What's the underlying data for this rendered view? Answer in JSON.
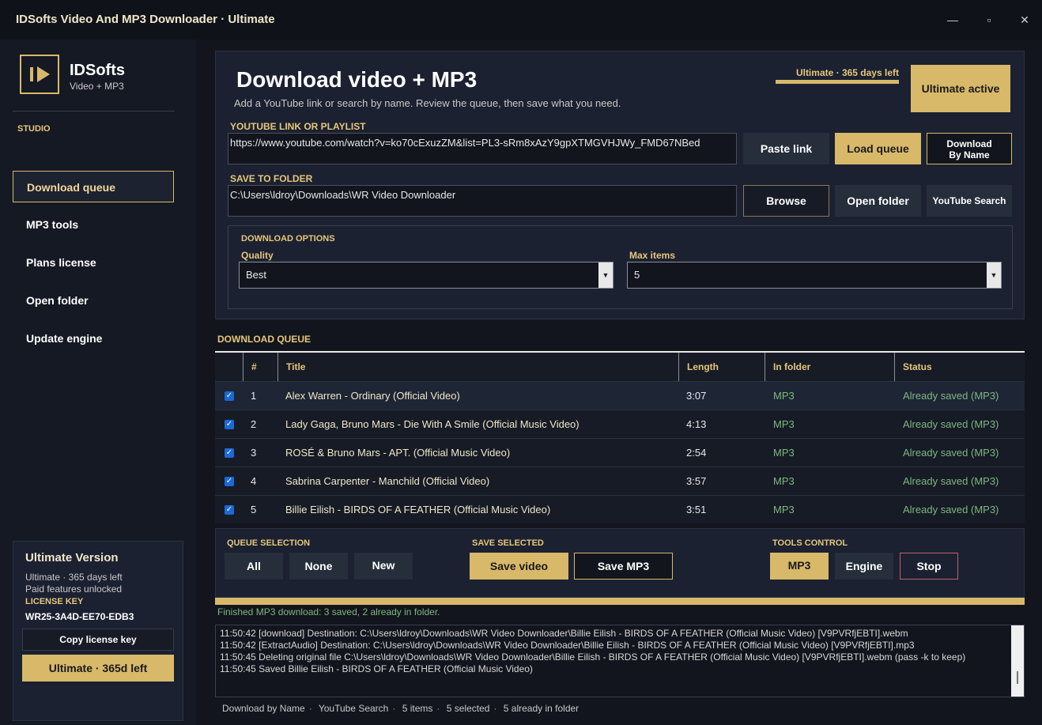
{
  "window": {
    "title": "IDSofts Video And MP3 Downloader  ·  Ultimate",
    "minimize": "—",
    "maximize": "▫",
    "close": "✕"
  },
  "sidebar": {
    "logo_name": "IDSofts",
    "logo_sub": "Video + MP3",
    "section": "STUDIO",
    "items": [
      {
        "label": "Download queue",
        "active": true
      },
      {
        "label": "MP3 tools",
        "active": false
      },
      {
        "label": "Plans  license",
        "active": false
      },
      {
        "label": "Open folder",
        "active": false
      },
      {
        "label": "Update engine",
        "active": false
      }
    ],
    "license_card": {
      "title": "Ultimate Version",
      "line1": "Ultimate · 365 days left",
      "line2": "Paid features unlocked",
      "key_label": "LICENSE KEY",
      "key": "WR25-3A4D-EE70-EDB3",
      "copy_button": "Copy license key",
      "ultimate_button": "Ultimate · 365d left"
    }
  },
  "main": {
    "heading": "Download video + MP3",
    "subheading": "Add a YouTube link or search by name. Review the queue, then save what you need.",
    "ultimate_status": "Ultimate · 365 days left",
    "ultimate_active": "Ultimate active",
    "link_label": "YOUTUBE LINK OR PLAYLIST",
    "link_value": "https://www.youtube.com/watch?v=ko70cExuzZM&list=PL3-sRm8xAzY9gpXTMGVHJWy_FMD67NBed",
    "paste_link": "Paste link",
    "load_queue": "Load queue",
    "download_by_name_1": "Download",
    "download_by_name_2": "By Name",
    "folder_label": "SAVE TO FOLDER",
    "folder_value": "C:\\Users\\ldroy\\Downloads\\WR Video Downloader",
    "browse": "Browse",
    "open_folder": "Open folder",
    "youtube_search": "YouTube Search",
    "options": {
      "label": "DOWNLOAD OPTIONS",
      "quality_label": "Quality",
      "quality_value": "Best",
      "max_label": "Max items",
      "max_value": "5"
    }
  },
  "queue": {
    "label": "DOWNLOAD QUEUE",
    "columns": [
      "#",
      "Title",
      "Length",
      "In folder",
      "Status"
    ],
    "rows": [
      {
        "num": "1",
        "title": "Alex Warren - Ordinary (Official Video)",
        "length": "3:07",
        "folder": "MP3",
        "status": "Already saved (MP3)",
        "checked": true
      },
      {
        "num": "2",
        "title": "Lady Gaga, Bruno Mars - Die With A Smile (Official Music Video)",
        "length": "4:13",
        "folder": "MP3",
        "status": "Already saved (MP3)",
        "checked": true
      },
      {
        "num": "3",
        "title": "ROSÉ & Bruno Mars - APT. (Official Music Video)",
        "length": "2:54",
        "folder": "MP3",
        "status": "Already saved (MP3)",
        "checked": true
      },
      {
        "num": "4",
        "title": "Sabrina Carpenter - Manchild (Official Video)",
        "length": "3:57",
        "folder": "MP3",
        "status": "Already saved (MP3)",
        "checked": true
      },
      {
        "num": "5",
        "title": "Billie Eilish - BIRDS OF A FEATHER (Official Music Video)",
        "length": "3:51",
        "folder": "MP3",
        "status": "Already saved (MP3)",
        "checked": true
      }
    ]
  },
  "controls": {
    "queue_selection_label": "QUEUE SELECTION",
    "all": "All",
    "none": "None",
    "new": "New",
    "save_selected_label": "SAVE SELECTED",
    "save_video": "Save video",
    "save_mp3": "Save MP3",
    "tools_label": "TOOLS  CONTROL",
    "mp3": "MP3",
    "engine": "Engine",
    "stop": "Stop"
  },
  "progress": 1.0,
  "finished_message": "Finished MP3 download: 3 saved, 2 already in folder.",
  "log": [
    "11:50:42  [download] Destination: C:\\Users\\ldroy\\Downloads\\WR Video Downloader\\Billie Eilish - BIRDS OF A FEATHER (Official Music Video) [V9PVRfjEBTI].webm",
    "11:50:42  [ExtractAudio] Destination: C:\\Users\\ldroy\\Downloads\\WR Video Downloader\\Billie Eilish - BIRDS OF A FEATHER (Official Music Video) [V9PVRfjEBTI].mp3",
    "11:50:45  Deleting original file C:\\Users\\ldroy\\Downloads\\WR Video Downloader\\Billie Eilish - BIRDS OF A FEATHER (Official Music Video) [V9PVRfjEBTI].webm (pass -k to keep)",
    "11:50:45  Saved Billie Eilish - BIRDS OF A FEATHER (Official Music Video)"
  ],
  "statusbar": [
    "Download by Name",
    "YouTube Search",
    "5 items",
    "5 selected",
    "5 already in folder"
  ],
  "colors": {
    "accent": "#d8b96a",
    "background": "#12151d",
    "panel": "#1b2131",
    "success": "#7fb77f",
    "danger": "#c0616b"
  }
}
